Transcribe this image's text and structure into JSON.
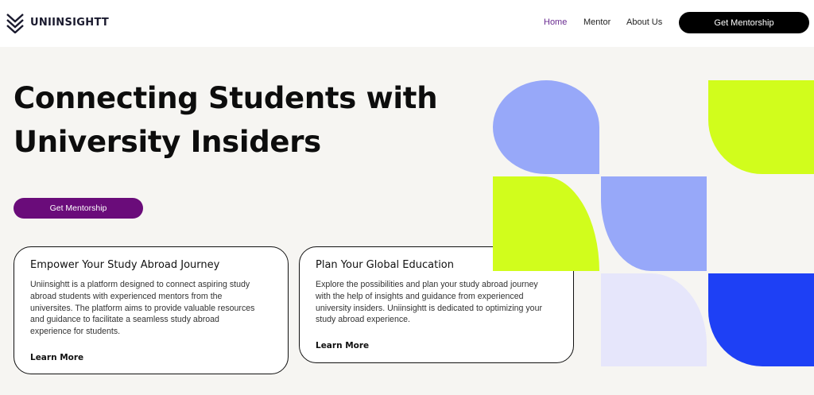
{
  "header": {
    "brand": "UNIINSIGHTT",
    "nav": [
      {
        "label": "Home",
        "active": true
      },
      {
        "label": "Mentor",
        "active": false
      },
      {
        "label": "About Us",
        "active": false
      }
    ],
    "cta_label": "Get Mentorship"
  },
  "hero": {
    "title_line1": "Connecting Students with",
    "title_line2": "University Insiders",
    "cta_label": "Get Mentorship"
  },
  "cards": [
    {
      "title": "Empower Your Study Abroad Journey",
      "body_lines": [
        "Uniinsightt is a platform designed to connect aspiring study",
        "abroad students with experienced mentors from the",
        "universites. The platform aims to provide valuable resources",
        "and guidance to facilitate a seamless study abroad",
        "experience for students."
      ],
      "link": "Learn More"
    },
    {
      "title": "Plan Your Global Education",
      "body_lines": [
        "Explore the possibilities and plan your study abroad journey",
        "with the help of insights and guidance from experienced",
        "university insiders. Uniinsightt is dedicated to optimizing your",
        "study abroad experience."
      ],
      "link": "Learn More"
    }
  ],
  "colors": {
    "accent_purple": "#6a0c7a",
    "nav_active": "#6a2c91",
    "periwinkle": "#97a8f9",
    "lime": "#d1fd1c",
    "blue": "#1e40f5",
    "lavender": "#e6e6fb"
  }
}
